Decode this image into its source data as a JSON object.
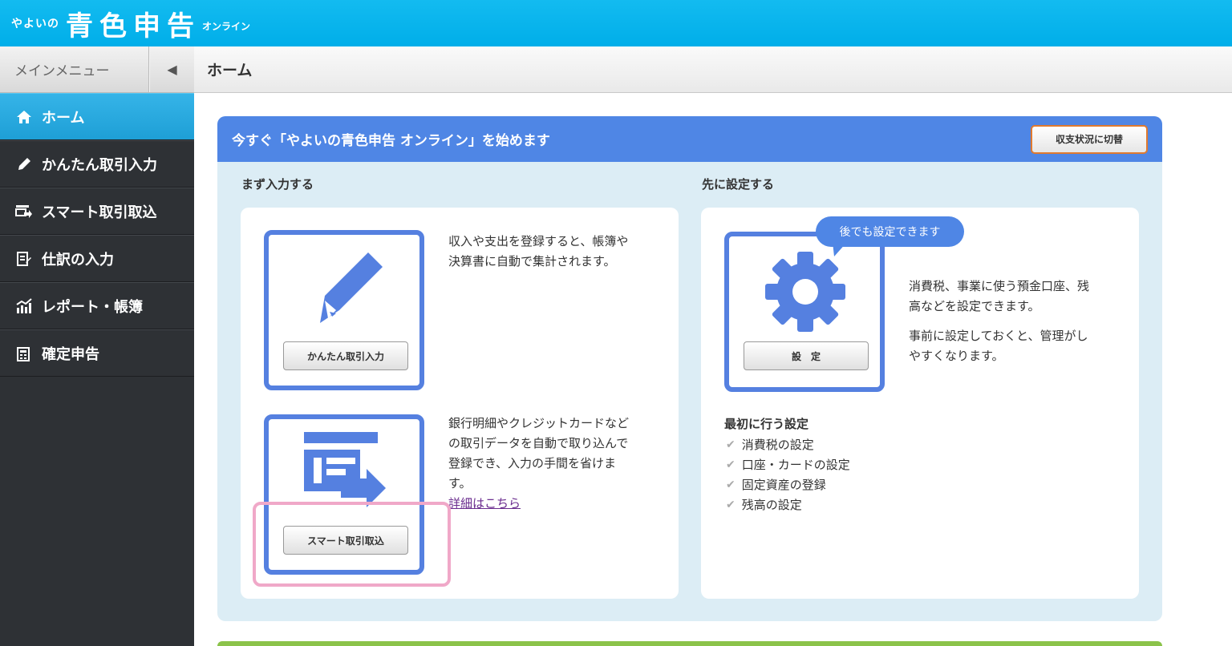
{
  "topbar": {
    "logo_small": "やよいの",
    "logo_big": "青色申告",
    "logo_sub": "オンライン"
  },
  "sidebar": {
    "header_label": "メインメニュー",
    "collapse_glyph": "◀",
    "items": [
      {
        "label": "ホーム",
        "icon": "home-icon",
        "active": true
      },
      {
        "label": "かんたん取引入力",
        "icon": "pencil-icon",
        "active": false
      },
      {
        "label": "スマート取引取込",
        "icon": "import-icon",
        "active": false
      },
      {
        "label": "仕訳の入力",
        "icon": "journal-icon",
        "active": false
      },
      {
        "label": "レポート・帳簿",
        "icon": "report-icon",
        "active": false
      },
      {
        "label": "確定申告",
        "icon": "tax-return-icon",
        "active": false
      }
    ]
  },
  "breadcrumb": {
    "title": "ホーム"
  },
  "card": {
    "title": "今すぐ「やよいの青色申告 オンライン」を始めます",
    "switch_button": "収支状況に切替",
    "left_section": "まず入力する",
    "right_section": "先に設定する",
    "entry_button": "かんたん取引入力",
    "entry_desc_1": "収入や支出を登録すると、帳簿や",
    "entry_desc_2": "決算書に自動で集計されます。",
    "import_button": "スマート取引取込",
    "import_desc_1": "銀行明細やクレジットカードなど",
    "import_desc_2": "の取引データを自動で取り込んで",
    "import_desc_3": "登録でき、入力の手間を省けま",
    "import_desc_4": "す。",
    "detail_link": "詳細はこちら",
    "settings_bubble": "後でも設定できます",
    "settings_button": "設　定",
    "settings_desc_1": "消費税、事業に使う預金口座、残",
    "settings_desc_2": "高などを設定できます。",
    "settings_desc_3": "事前に設定しておくと、管理がし",
    "settings_desc_4": "やすくなります。",
    "first_settings_title": "最初に行う設定",
    "first_settings": [
      "消費税の設定",
      "口座・カードの設定",
      "固定資産の登録",
      "残高の設定"
    ]
  },
  "colors": {
    "topbar": "#00aee9",
    "sidebar": "#2e3135",
    "accent_blue": "#4f86e5",
    "card_bg": "#dcedf5",
    "highlight_pink": "#f0a8c8",
    "switch_border": "#e07a2e"
  }
}
